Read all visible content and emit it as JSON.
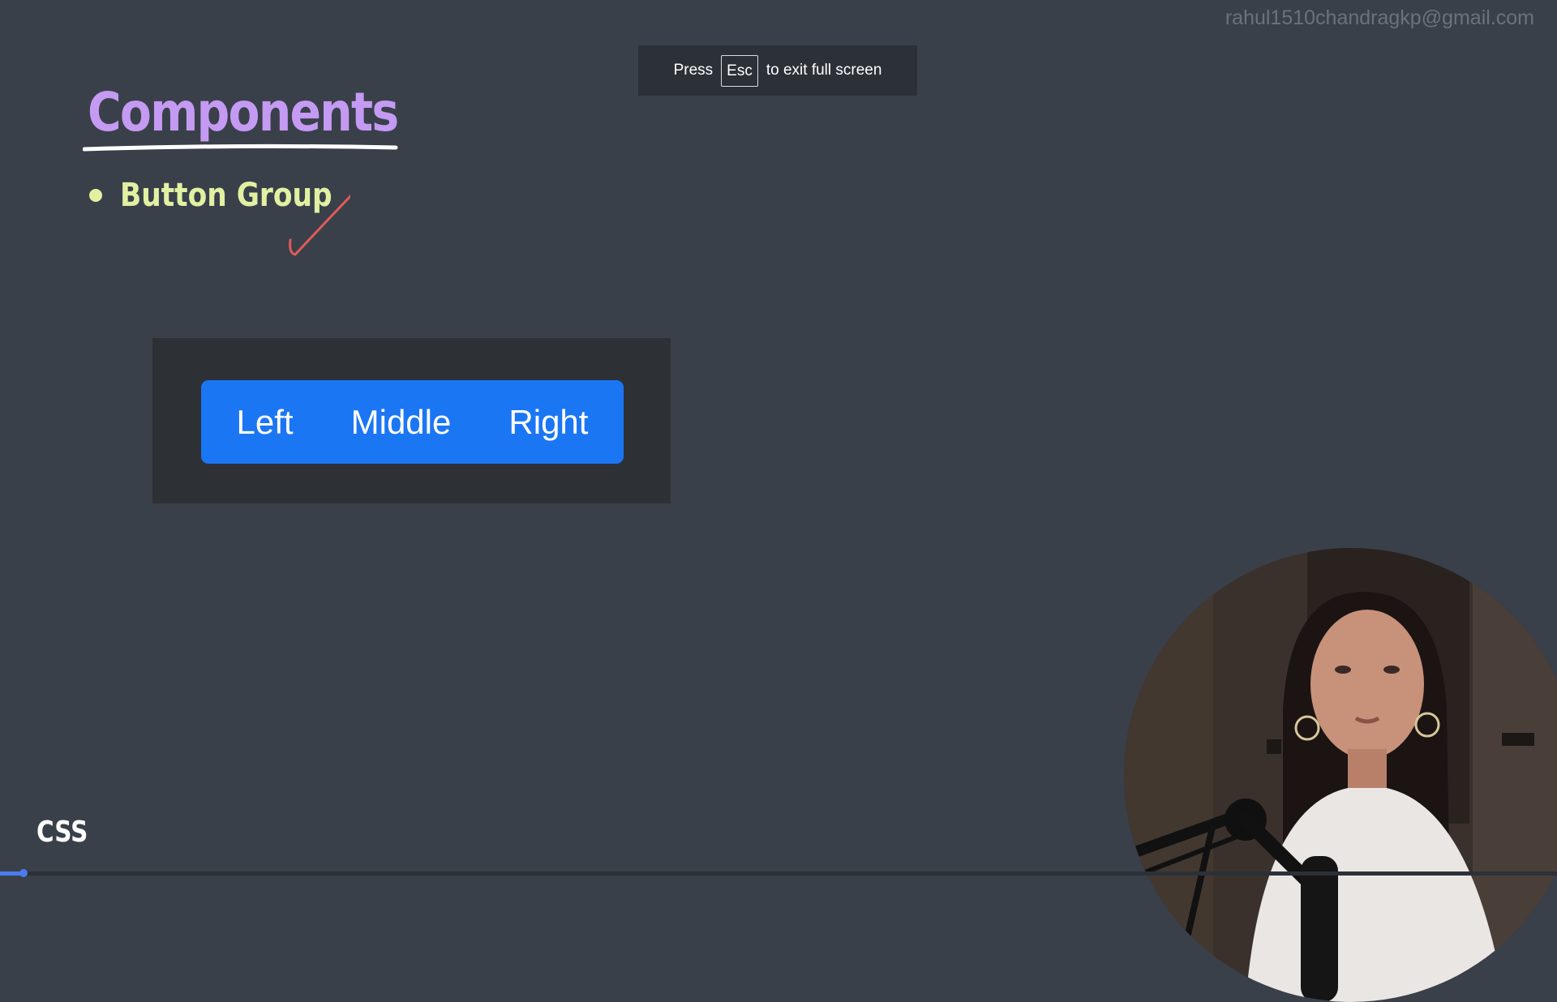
{
  "watermark": {
    "email": "rahul1510chandragkp@gmail.com"
  },
  "fullscreen_notice": {
    "prefix": "Press",
    "key": "Esc",
    "suffix": "to exit full screen"
  },
  "slide": {
    "title": "Components",
    "bullets": [
      {
        "label": "Button Group",
        "checked": true
      }
    ],
    "footer_label": "CSS"
  },
  "demo": {
    "buttons": [
      {
        "label": "Left"
      },
      {
        "label": "Middle"
      },
      {
        "label": "Right"
      }
    ],
    "accent_color": "#1b76f4"
  },
  "video": {
    "progress_fraction": 0.015
  },
  "colors": {
    "background": "#39404a",
    "title": "#c49af3",
    "bullet": "#e2f0a2",
    "checkmark": "#e05a5a"
  }
}
